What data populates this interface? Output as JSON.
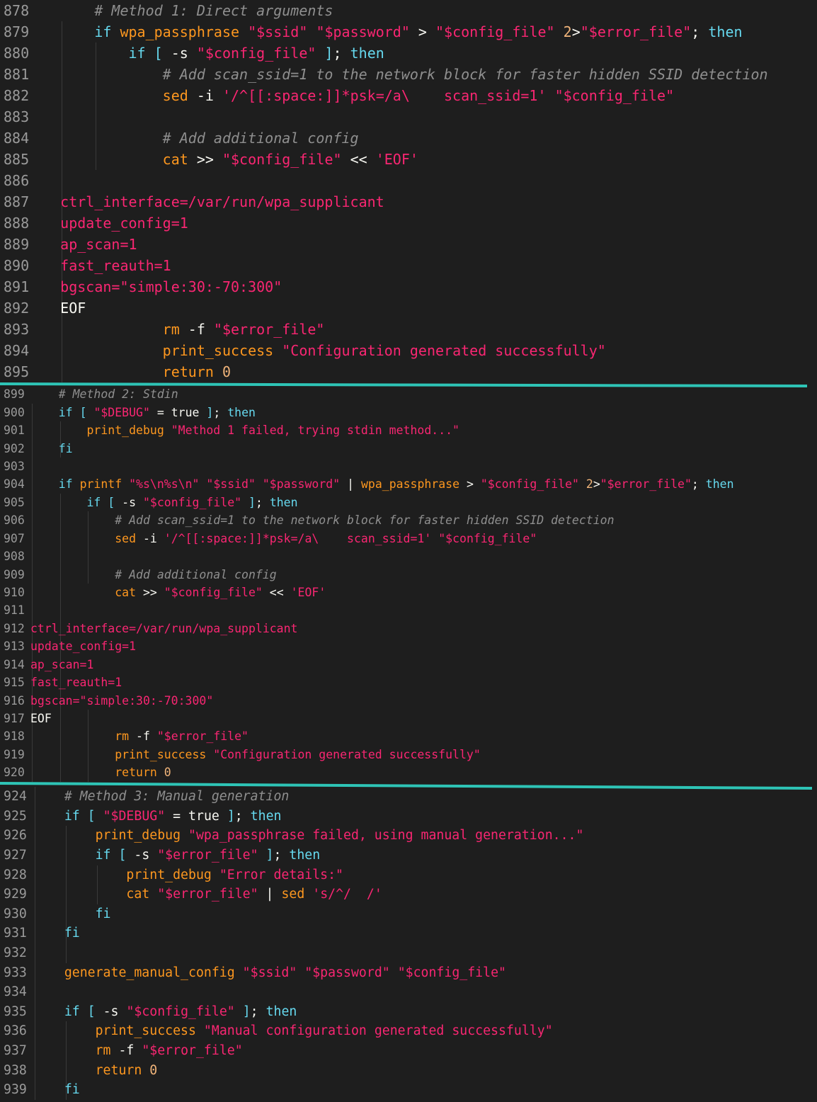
{
  "colors": {
    "background": "#1e1e1e",
    "separator": "#2ec4b6",
    "keyword": "#66d9ef",
    "function": "#fd971f",
    "string": "#e6db74",
    "pink": "#f92672",
    "comment": "#8f8f8f"
  },
  "sections": [
    {
      "lines": [
        {
          "n": "878",
          "t": "        # Method 1: Direct arguments"
        },
        {
          "n": "879",
          "t": "        if wpa_passphrase \"$ssid\" \"$password\" > \"$config_file\" 2>\"$error_file\"; then"
        },
        {
          "n": "880",
          "t": "            if [ -s \"$config_file\" ]; then"
        },
        {
          "n": "881",
          "t": "                # Add scan_ssid=1 to the network block for faster hidden SSID detection"
        },
        {
          "n": "882",
          "t": "                sed -i '/^[[:space:]]*psk=/a\\    scan_ssid=1' \"$config_file\""
        },
        {
          "n": "883",
          "t": ""
        },
        {
          "n": "884",
          "t": "                # Add additional config"
        },
        {
          "n": "885",
          "t": "                cat >> \"$config_file\" << 'EOF'"
        },
        {
          "n": "886",
          "t": ""
        },
        {
          "n": "887",
          "t": "    ctrl_interface=/var/run/wpa_supplicant"
        },
        {
          "n": "888",
          "t": "    update_config=1"
        },
        {
          "n": "889",
          "t": "    ap_scan=1"
        },
        {
          "n": "890",
          "t": "    fast_reauth=1"
        },
        {
          "n": "891",
          "t": "    bgscan=\"simple:30:-70:300\""
        },
        {
          "n": "892",
          "t": "    EOF"
        },
        {
          "n": "893",
          "t": "                rm -f \"$error_file\""
        },
        {
          "n": "894",
          "t": "                print_success \"Configuration generated successfully\""
        },
        {
          "n": "895",
          "t": "                return 0"
        }
      ]
    },
    {
      "lines": [
        {
          "n": "899",
          "t": "    # Method 2: Stdin"
        },
        {
          "n": "900",
          "t": "    if [ \"$DEBUG\" = true ]; then"
        },
        {
          "n": "901",
          "t": "        print_debug \"Method 1 failed, trying stdin method...\""
        },
        {
          "n": "902",
          "t": "    fi"
        },
        {
          "n": "903",
          "t": ""
        },
        {
          "n": "904",
          "t": "    if printf \"%s\\n%s\\n\" \"$ssid\" \"$password\" | wpa_passphrase > \"$config_file\" 2>\"$error_file\"; then"
        },
        {
          "n": "905",
          "t": "        if [ -s \"$config_file\" ]; then"
        },
        {
          "n": "906",
          "t": "            # Add scan_ssid=1 to the network block for faster hidden SSID detection"
        },
        {
          "n": "907",
          "t": "            sed -i '/^[[:space:]]*psk=/a\\    scan_ssid=1' \"$config_file\""
        },
        {
          "n": "908",
          "t": ""
        },
        {
          "n": "909",
          "t": "            # Add additional config"
        },
        {
          "n": "910",
          "t": "            cat >> \"$config_file\" << 'EOF'"
        },
        {
          "n": "911",
          "t": ""
        },
        {
          "n": "912",
          "t": "ctrl_interface=/var/run/wpa_supplicant"
        },
        {
          "n": "913",
          "t": "update_config=1"
        },
        {
          "n": "914",
          "t": "ap_scan=1"
        },
        {
          "n": "915",
          "t": "fast_reauth=1"
        },
        {
          "n": "916",
          "t": "bgscan=\"simple:30:-70:300\""
        },
        {
          "n": "917",
          "t": "EOF"
        },
        {
          "n": "918",
          "t": "            rm -f \"$error_file\""
        },
        {
          "n": "919",
          "t": "            print_success \"Configuration generated successfully\""
        },
        {
          "n": "920",
          "t": "            return 0"
        }
      ]
    },
    {
      "lines": [
        {
          "n": "924",
          "t": "    # Method 3: Manual generation"
        },
        {
          "n": "925",
          "t": "    if [ \"$DEBUG\" = true ]; then"
        },
        {
          "n": "926",
          "t": "        print_debug \"wpa_passphrase failed, using manual generation...\""
        },
        {
          "n": "927",
          "t": "        if [ -s \"$error_file\" ]; then"
        },
        {
          "n": "928",
          "t": "            print_debug \"Error details:\""
        },
        {
          "n": "929",
          "t": "            cat \"$error_file\" | sed 's/^/  /'"
        },
        {
          "n": "930",
          "t": "        fi"
        },
        {
          "n": "931",
          "t": "    fi"
        },
        {
          "n": "932",
          "t": ""
        },
        {
          "n": "933",
          "t": "    generate_manual_config \"$ssid\" \"$password\" \"$config_file\""
        },
        {
          "n": "934",
          "t": ""
        },
        {
          "n": "935",
          "t": "    if [ -s \"$config_file\" ]; then"
        },
        {
          "n": "936",
          "t": "        print_success \"Manual configuration generated successfully\""
        },
        {
          "n": "937",
          "t": "        rm -f \"$error_file\""
        },
        {
          "n": "938",
          "t": "        return 0"
        },
        {
          "n": "939",
          "t": "    fi"
        }
      ]
    }
  ]
}
